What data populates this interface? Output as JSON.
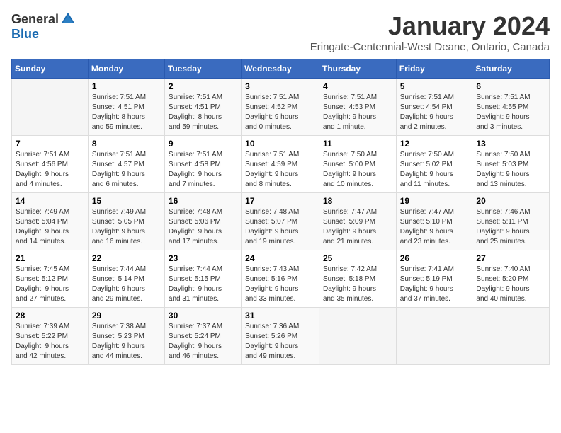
{
  "logo": {
    "general": "General",
    "blue": "Blue"
  },
  "title": "January 2024",
  "subtitle": "Eringate-Centennial-West Deane, Ontario, Canada",
  "headers": [
    "Sunday",
    "Monday",
    "Tuesday",
    "Wednesday",
    "Thursday",
    "Friday",
    "Saturday"
  ],
  "weeks": [
    [
      {
        "day": "",
        "info": ""
      },
      {
        "day": "1",
        "info": "Sunrise: 7:51 AM\nSunset: 4:51 PM\nDaylight: 8 hours\nand 59 minutes."
      },
      {
        "day": "2",
        "info": "Sunrise: 7:51 AM\nSunset: 4:51 PM\nDaylight: 8 hours\nand 59 minutes."
      },
      {
        "day": "3",
        "info": "Sunrise: 7:51 AM\nSunset: 4:52 PM\nDaylight: 9 hours\nand 0 minutes."
      },
      {
        "day": "4",
        "info": "Sunrise: 7:51 AM\nSunset: 4:53 PM\nDaylight: 9 hours\nand 1 minute."
      },
      {
        "day": "5",
        "info": "Sunrise: 7:51 AM\nSunset: 4:54 PM\nDaylight: 9 hours\nand 2 minutes."
      },
      {
        "day": "6",
        "info": "Sunrise: 7:51 AM\nSunset: 4:55 PM\nDaylight: 9 hours\nand 3 minutes."
      }
    ],
    [
      {
        "day": "7",
        "info": "Sunrise: 7:51 AM\nSunset: 4:56 PM\nDaylight: 9 hours\nand 4 minutes."
      },
      {
        "day": "8",
        "info": "Sunrise: 7:51 AM\nSunset: 4:57 PM\nDaylight: 9 hours\nand 6 minutes."
      },
      {
        "day": "9",
        "info": "Sunrise: 7:51 AM\nSunset: 4:58 PM\nDaylight: 9 hours\nand 7 minutes."
      },
      {
        "day": "10",
        "info": "Sunrise: 7:51 AM\nSunset: 4:59 PM\nDaylight: 9 hours\nand 8 minutes."
      },
      {
        "day": "11",
        "info": "Sunrise: 7:50 AM\nSunset: 5:00 PM\nDaylight: 9 hours\nand 10 minutes."
      },
      {
        "day": "12",
        "info": "Sunrise: 7:50 AM\nSunset: 5:02 PM\nDaylight: 9 hours\nand 11 minutes."
      },
      {
        "day": "13",
        "info": "Sunrise: 7:50 AM\nSunset: 5:03 PM\nDaylight: 9 hours\nand 13 minutes."
      }
    ],
    [
      {
        "day": "14",
        "info": "Sunrise: 7:49 AM\nSunset: 5:04 PM\nDaylight: 9 hours\nand 14 minutes."
      },
      {
        "day": "15",
        "info": "Sunrise: 7:49 AM\nSunset: 5:05 PM\nDaylight: 9 hours\nand 16 minutes."
      },
      {
        "day": "16",
        "info": "Sunrise: 7:48 AM\nSunset: 5:06 PM\nDaylight: 9 hours\nand 17 minutes."
      },
      {
        "day": "17",
        "info": "Sunrise: 7:48 AM\nSunset: 5:07 PM\nDaylight: 9 hours\nand 19 minutes."
      },
      {
        "day": "18",
        "info": "Sunrise: 7:47 AM\nSunset: 5:09 PM\nDaylight: 9 hours\nand 21 minutes."
      },
      {
        "day": "19",
        "info": "Sunrise: 7:47 AM\nSunset: 5:10 PM\nDaylight: 9 hours\nand 23 minutes."
      },
      {
        "day": "20",
        "info": "Sunrise: 7:46 AM\nSunset: 5:11 PM\nDaylight: 9 hours\nand 25 minutes."
      }
    ],
    [
      {
        "day": "21",
        "info": "Sunrise: 7:45 AM\nSunset: 5:12 PM\nDaylight: 9 hours\nand 27 minutes."
      },
      {
        "day": "22",
        "info": "Sunrise: 7:44 AM\nSunset: 5:14 PM\nDaylight: 9 hours\nand 29 minutes."
      },
      {
        "day": "23",
        "info": "Sunrise: 7:44 AM\nSunset: 5:15 PM\nDaylight: 9 hours\nand 31 minutes."
      },
      {
        "day": "24",
        "info": "Sunrise: 7:43 AM\nSunset: 5:16 PM\nDaylight: 9 hours\nand 33 minutes."
      },
      {
        "day": "25",
        "info": "Sunrise: 7:42 AM\nSunset: 5:18 PM\nDaylight: 9 hours\nand 35 minutes."
      },
      {
        "day": "26",
        "info": "Sunrise: 7:41 AM\nSunset: 5:19 PM\nDaylight: 9 hours\nand 37 minutes."
      },
      {
        "day": "27",
        "info": "Sunrise: 7:40 AM\nSunset: 5:20 PM\nDaylight: 9 hours\nand 40 minutes."
      }
    ],
    [
      {
        "day": "28",
        "info": "Sunrise: 7:39 AM\nSunset: 5:22 PM\nDaylight: 9 hours\nand 42 minutes."
      },
      {
        "day": "29",
        "info": "Sunrise: 7:38 AM\nSunset: 5:23 PM\nDaylight: 9 hours\nand 44 minutes."
      },
      {
        "day": "30",
        "info": "Sunrise: 7:37 AM\nSunset: 5:24 PM\nDaylight: 9 hours\nand 46 minutes."
      },
      {
        "day": "31",
        "info": "Sunrise: 7:36 AM\nSunset: 5:26 PM\nDaylight: 9 hours\nand 49 minutes."
      },
      {
        "day": "",
        "info": ""
      },
      {
        "day": "",
        "info": ""
      },
      {
        "day": "",
        "info": ""
      }
    ]
  ]
}
